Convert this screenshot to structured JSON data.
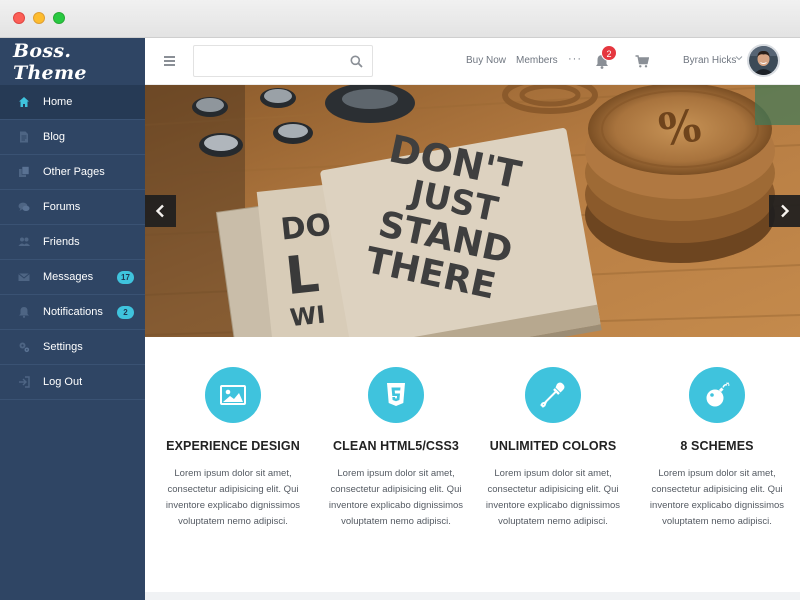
{
  "sidebar": {
    "brand": "Boss. Theme",
    "items": [
      {
        "label": "Home",
        "icon": "home-icon"
      },
      {
        "label": "Blog",
        "icon": "document-icon"
      },
      {
        "label": "Other Pages",
        "icon": "pages-icon"
      },
      {
        "label": "Forums",
        "icon": "chat-icon"
      },
      {
        "label": "Friends",
        "icon": "people-icon"
      },
      {
        "label": "Messages",
        "icon": "mail-icon",
        "badge": "17"
      },
      {
        "label": "Notifications",
        "icon": "bell-icon",
        "badge": "2"
      },
      {
        "label": "Settings",
        "icon": "gear-icon"
      },
      {
        "label": "Log Out",
        "icon": "logout-icon"
      }
    ],
    "active_index": 0
  },
  "topbar": {
    "search_placeholder": "",
    "links": [
      "Buy Now",
      "Members"
    ],
    "more": "···",
    "notification_count": "2",
    "user_name": "Byran Hicks"
  },
  "hero": {
    "notebook_text": [
      "DON'T",
      "JUST",
      "STAND",
      "THERE"
    ]
  },
  "features": [
    {
      "title": "EXPERIENCE DESIGN",
      "icon": "image-icon",
      "text": "Lorem ipsum dolor sit amet, consectetur adipisicing elit. Qui inventore explicabo dignissimos voluptatem nemo adipisci."
    },
    {
      "title": "CLEAN HTML5/CSS3",
      "icon": "html5-icon",
      "text": "Lorem ipsum dolor sit amet, consectetur adipisicing elit. Qui inventore explicabo dignissimos voluptatem nemo adipisci."
    },
    {
      "title": "UNLIMITED COLORS",
      "icon": "eyedropper-icon",
      "text": "Lorem ipsum dolor sit amet, consectetur adipisicing elit. Qui inventore explicabo dignissimos voluptatem nemo adipisci."
    },
    {
      "title": "8 SCHEMES",
      "icon": "bomb-icon",
      "text": "Lorem ipsum dolor sit amet, consectetur adipisicing elit. Qui inventore explicabo dignissimos voluptatem nemo adipisci."
    }
  ],
  "colors": {
    "sidebar_bg": "#2f4564",
    "sidebar_active": "#263a55",
    "accent": "#3fc3dd",
    "notification_badge": "#e5373f"
  }
}
